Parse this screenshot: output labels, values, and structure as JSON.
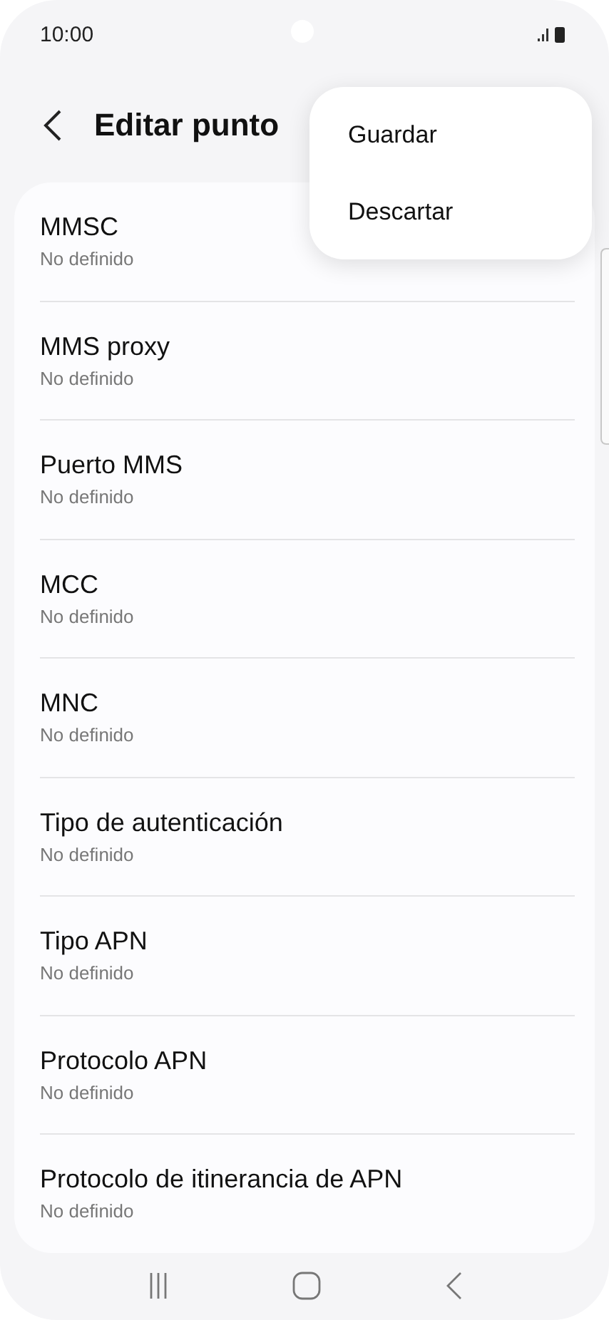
{
  "status_bar": {
    "time": "10:00"
  },
  "header": {
    "title": "Editar punto"
  },
  "menu": {
    "items": [
      {
        "label": "Guardar"
      },
      {
        "label": "Descartar"
      }
    ]
  },
  "settings": [
    {
      "label": "MMSC",
      "value": "No definido"
    },
    {
      "label": "MMS proxy",
      "value": "No definido"
    },
    {
      "label": "Puerto MMS",
      "value": "No definido"
    },
    {
      "label": "MCC",
      "value": "No definido"
    },
    {
      "label": "MNC",
      "value": "No definido"
    },
    {
      "label": "Tipo de autenticación",
      "value": "No definido"
    },
    {
      "label": "Tipo APN",
      "value": "No definido"
    },
    {
      "label": "Protocolo APN",
      "value": "No definido"
    },
    {
      "label": "Protocolo de itinerancia de APN",
      "value": "No definido"
    }
  ]
}
